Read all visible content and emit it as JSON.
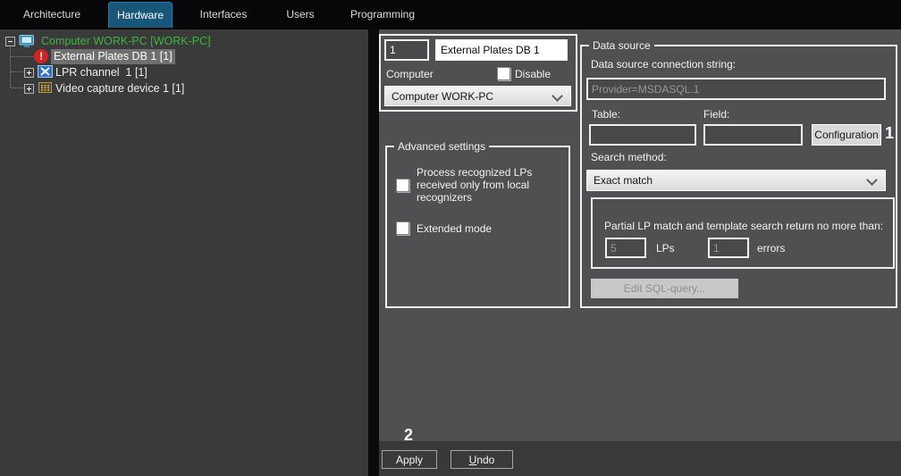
{
  "tabs": [
    {
      "label": "Architecture"
    },
    {
      "label": "Hardware"
    },
    {
      "label": "Interfaces"
    },
    {
      "label": "Users"
    },
    {
      "label": "Programming"
    }
  ],
  "tree": {
    "items": [
      {
        "label": "Computer WORK-PC [WORK-PC]",
        "icon": "computer-icon",
        "expanded": true
      },
      {
        "label": "External Plates DB 1 [1]",
        "icon": "alert-icon",
        "selected": true
      },
      {
        "label": "LPR channel  1 [1]",
        "icon": "lpr-channel-icon",
        "collapsed": true
      },
      {
        "label": "Video capture device 1 [1]",
        "icon": "video-capture-icon",
        "collapsed": true
      }
    ]
  },
  "object_panel": {
    "id_value": "1",
    "name_value": "External Plates DB 1",
    "computer_label": "Computer",
    "disable_label": "Disable",
    "computer_selected": "Computer WORK-PC"
  },
  "advanced": {
    "title": "Advanced settings",
    "process_label": "Process recognized LPs received only from local recognizers",
    "extended_label": "Extended mode"
  },
  "data_source": {
    "title": "Data source",
    "connection_label": "Data source connection string:",
    "connection_value": "Provider=MSDASQL.1",
    "table_label": "Table:",
    "field_label": "Field:",
    "table_value": "",
    "field_value": "",
    "configuration_label": "Configuration",
    "search_method_label": "Search method:",
    "search_method_value": "Exact match",
    "partial_label": "Partial LP match and template search return no more than:",
    "lps_value": "5",
    "lps_label": "LPs",
    "errors_value": "1",
    "errors_label": "errors",
    "edit_sql_label": "Edit SQL-query..."
  },
  "footer": {
    "apply_label": "Apply",
    "undo_first": "U",
    "undo_rest": "ndo"
  },
  "annotations": {
    "step1": "1",
    "step2": "2"
  },
  "colors": {
    "tab_active": "#19577a",
    "tree_root_green": "#3db53d",
    "alert_red": "#d52222",
    "selection_gray": "#6f6f6f",
    "main_panel": "#505053",
    "dark_panel": "#3a3a3a"
  }
}
